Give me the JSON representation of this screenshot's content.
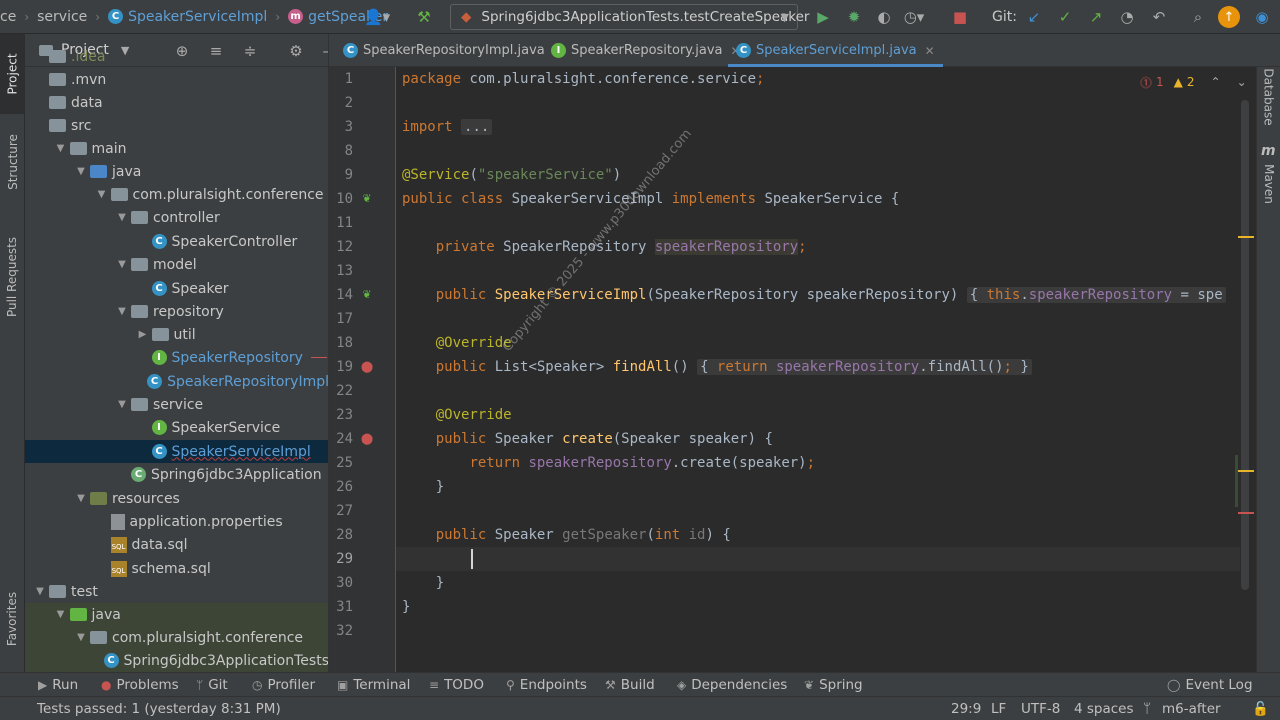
{
  "nav": {
    "crumb_pkg_tail": "ce",
    "crumb_service": "service",
    "crumb_class": "SpeakerServiceImpl",
    "crumb_method": "getSpeaker",
    "run_config": "Spring6jdbc3ApplicationTests.testCreateSpeaker",
    "git_label": "Git:"
  },
  "left_stripe": {
    "project": "Project",
    "structure": "Structure",
    "pull_requests": "Pull Requests",
    "favorites": "Favorites"
  },
  "right_stripe": {
    "database": "Database",
    "maven": "Maven"
  },
  "project_panel": {
    "title": "Project",
    "tree": [
      {
        "label": ".idea",
        "indent": 0,
        "kind": "folder",
        "arrow": ""
      },
      {
        "label": ".mvn",
        "indent": 0,
        "kind": "folder",
        "arrow": ""
      },
      {
        "label": "data",
        "indent": 0,
        "kind": "folder",
        "arrow": ""
      },
      {
        "label": "src",
        "indent": 0,
        "kind": "folder",
        "arrow": ""
      },
      {
        "label": "main",
        "indent": 1,
        "kind": "folder",
        "arrow": "▼"
      },
      {
        "label": "java",
        "indent": 2,
        "kind": "src",
        "arrow": "▼"
      },
      {
        "label": "com.pluralsight.conference",
        "indent": 3,
        "kind": "pkg",
        "arrow": "▼"
      },
      {
        "label": "controller",
        "indent": 4,
        "kind": "pkg",
        "arrow": "▼"
      },
      {
        "label": "SpeakerController",
        "indent": 5,
        "kind": "class",
        "arrow": ""
      },
      {
        "label": "model",
        "indent": 4,
        "kind": "pkg",
        "arrow": "▼"
      },
      {
        "label": "Speaker",
        "indent": 5,
        "kind": "class",
        "arrow": ""
      },
      {
        "label": "repository",
        "indent": 4,
        "kind": "pkg",
        "arrow": "▼"
      },
      {
        "label": "util",
        "indent": 5,
        "kind": "pkg",
        "arrow": "▶"
      },
      {
        "label": "SpeakerRepository",
        "indent": 5,
        "kind": "iface-new",
        "arrow": ""
      },
      {
        "label": "SpeakerRepositoryImpl",
        "indent": 5,
        "kind": "class-new",
        "arrow": ""
      },
      {
        "label": "service",
        "indent": 4,
        "kind": "pkg",
        "arrow": "▼"
      },
      {
        "label": "SpeakerService",
        "indent": 5,
        "kind": "iface",
        "arrow": ""
      },
      {
        "label": "SpeakerServiceImpl",
        "indent": 5,
        "kind": "class-new-sel",
        "arrow": ""
      },
      {
        "label": "Spring6jdbc3Application",
        "indent": 4,
        "kind": "spring",
        "arrow": ""
      },
      {
        "label": "resources",
        "indent": 2,
        "kind": "res",
        "arrow": "▼"
      },
      {
        "label": "application.properties",
        "indent": 3,
        "kind": "prop",
        "arrow": ""
      },
      {
        "label": "data.sql",
        "indent": 3,
        "kind": "sql",
        "arrow": ""
      },
      {
        "label": "schema.sql",
        "indent": 3,
        "kind": "sql",
        "arrow": ""
      },
      {
        "label": "test",
        "indent": 0,
        "kind": "folder",
        "arrow": "▼"
      },
      {
        "label": "java",
        "indent": 1,
        "kind": "src-test",
        "arrow": "▼"
      },
      {
        "label": "com.pluralsight.conference",
        "indent": 2,
        "kind": "pkg-test",
        "arrow": "▼"
      },
      {
        "label": "Spring6jdbc3ApplicationTests",
        "indent": 3,
        "kind": "class-test",
        "arrow": ""
      }
    ]
  },
  "editor": {
    "tabs": [
      {
        "label": "SpeakerRepositoryImpl.java",
        "icon": "C"
      },
      {
        "label": "SpeakerRepository.java",
        "icon": "I"
      },
      {
        "label": "SpeakerServiceImpl.java",
        "icon": "C"
      }
    ],
    "inspections": {
      "errors": "1",
      "warnings": "2"
    },
    "line_numbers": [
      "1",
      "2",
      "3",
      "8",
      "9",
      "10",
      "11",
      "12",
      "13",
      "14",
      "17",
      "18",
      "19",
      "22",
      "23",
      "24",
      "25",
      "26",
      "27",
      "28",
      "29",
      "30",
      "31",
      "32"
    ],
    "watermark": "Copyright © 2025 - www.p30download.com"
  },
  "tool_windows": {
    "run": "Run",
    "problems": "Problems",
    "git": "Git",
    "profiler": "Profiler",
    "terminal": "Terminal",
    "todo": "TODO",
    "endpoints": "Endpoints",
    "build": "Build",
    "dependencies": "Dependencies",
    "spring": "Spring",
    "event_log": "Event Log"
  },
  "status": {
    "message": "Tests passed: 1 (yesterday 8:31 PM)",
    "position": "29:9",
    "line_sep": "LF",
    "encoding": "UTF-8",
    "indent": "4 spaces",
    "branch": "m6-after"
  }
}
